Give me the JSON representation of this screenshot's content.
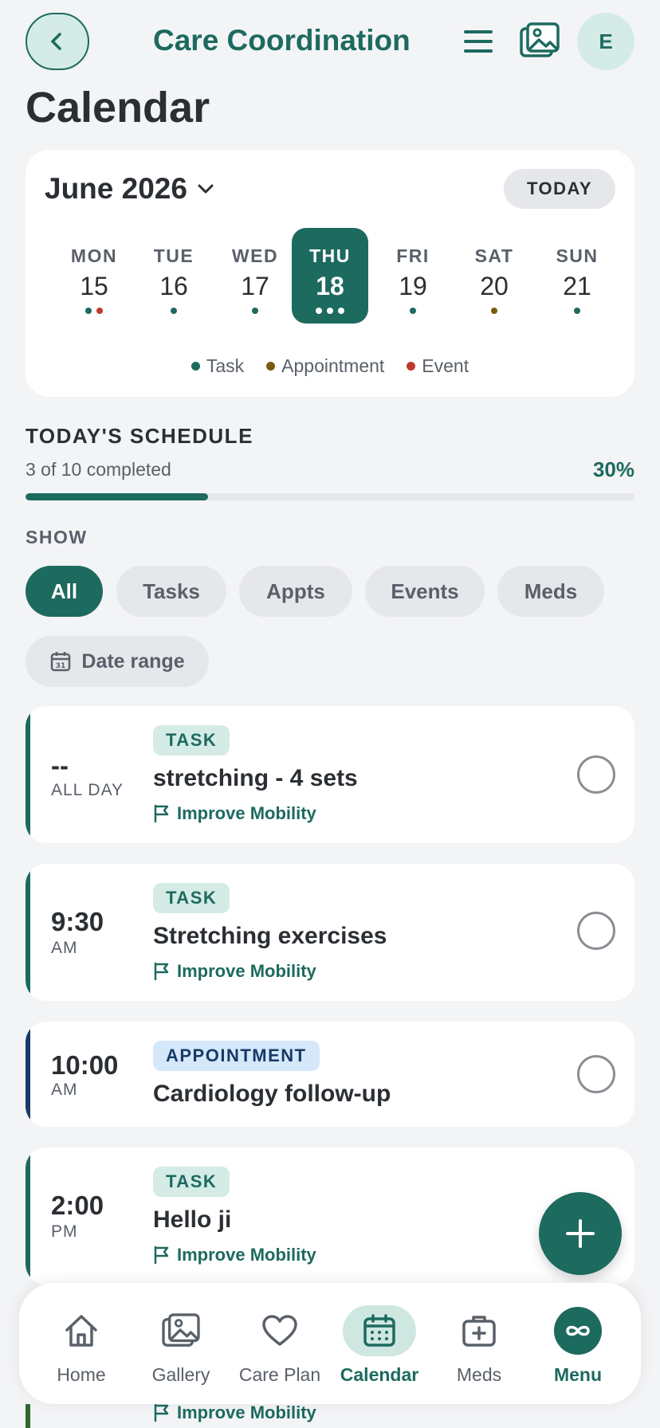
{
  "header": {
    "title": "Care Coordination",
    "avatar_initial": "E",
    "icons": [
      "back-arrow-icon",
      "hamburger-icon",
      "gallery-icon"
    ]
  },
  "page": {
    "title": "Calendar"
  },
  "calendar": {
    "month": "June 2026",
    "today_label": "TODAY",
    "days": [
      {
        "dow": "MON",
        "num": "15",
        "dots": [
          "task",
          "event"
        ],
        "selected": false
      },
      {
        "dow": "TUE",
        "num": "16",
        "dots": [
          "task"
        ],
        "selected": false
      },
      {
        "dow": "WED",
        "num": "17",
        "dots": [
          "task"
        ],
        "selected": false
      },
      {
        "dow": "THU",
        "num": "18",
        "dots": [
          "white",
          "white",
          "white"
        ],
        "selected": true
      },
      {
        "dow": "FRI",
        "num": "19",
        "dots": [
          "task"
        ],
        "selected": false
      },
      {
        "dow": "SAT",
        "num": "20",
        "dots": [
          "appointment"
        ],
        "selected": false
      },
      {
        "dow": "SUN",
        "num": "21",
        "dots": [
          "task"
        ],
        "selected": false
      }
    ],
    "legend": [
      {
        "label": "Task",
        "color": "#1d6a5f"
      },
      {
        "label": "Appointment",
        "color": "#7a5b0e"
      },
      {
        "label": "Event",
        "color": "#c0392b"
      }
    ]
  },
  "schedule": {
    "title": "TODAY'S SCHEDULE",
    "subtitle": "3 of 10 completed",
    "percent_label": "30%",
    "progress": 0.3
  },
  "filters": {
    "label": "SHOW",
    "chips": [
      "All",
      "Tasks",
      "Appts",
      "Events",
      "Meds"
    ],
    "active": "All",
    "date_range": "Date range"
  },
  "items": [
    {
      "time": "--",
      "ampm": "ALL DAY",
      "tag": "TASK",
      "type": "task",
      "title": "stretching - 4 sets",
      "goal": "Improve Mobility",
      "bar_color": "#1d6a5f"
    },
    {
      "time": "9:30",
      "ampm": "AM",
      "tag": "TASK",
      "type": "task",
      "title": "Stretching exercises",
      "goal": "Improve Mobility",
      "bar_color": "#1d6a5f"
    },
    {
      "time": "10:00",
      "ampm": "AM",
      "tag": "APPOINTMENT",
      "type": "appt",
      "title": "Cardiology follow-up",
      "goal": "",
      "bar_color": "#173a66"
    },
    {
      "time": "2:00",
      "ampm": "PM",
      "tag": "TASK",
      "type": "task",
      "title": "Hello ji",
      "goal": "Improve Mobility",
      "bar_color": "#1d6a5f"
    }
  ],
  "peek_goal": "Improve Mobility",
  "nav": [
    {
      "label": "Home",
      "icon": "home-icon"
    },
    {
      "label": "Gallery",
      "icon": "gallery-icon"
    },
    {
      "label": "Care Plan",
      "icon": "heart-icon"
    },
    {
      "label": "Calendar",
      "icon": "calendar-icon",
      "active": true
    },
    {
      "label": "Meds",
      "icon": "medkit-icon"
    },
    {
      "label": "Menu",
      "icon": "infinity-icon"
    }
  ],
  "colors": {
    "primary": "#1d6a5f",
    "task_dot": "#1d6a5f",
    "appointment_dot": "#7a5b0e",
    "event_dot": "#c0392b"
  }
}
